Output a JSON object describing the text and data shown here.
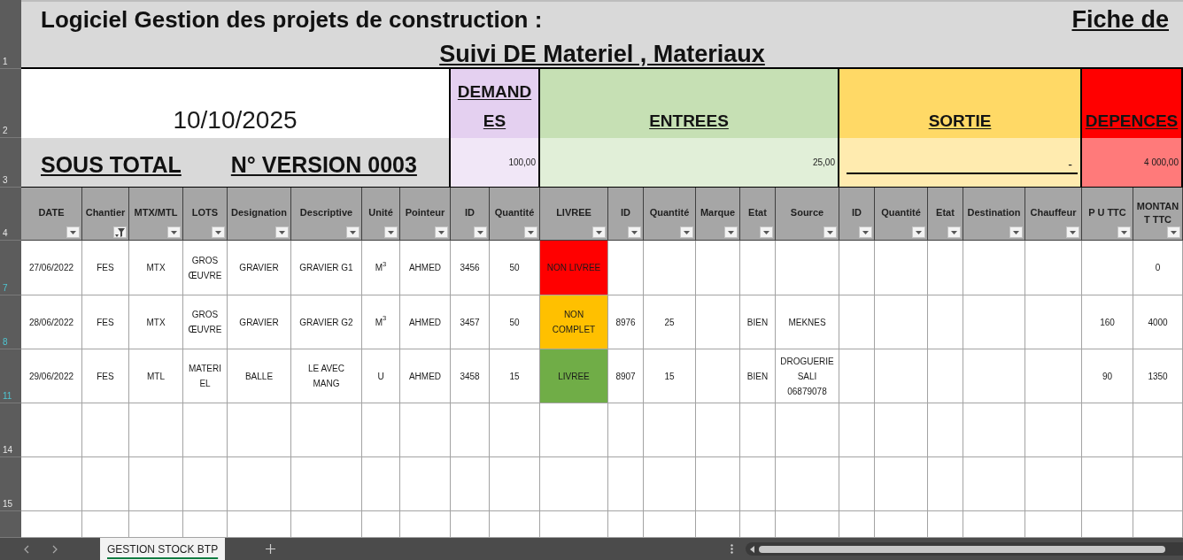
{
  "title_row": {
    "title": "Logiciel Gestion des projets de construction :",
    "right_title": "Fiche de",
    "subtitle": "Suivi DE Materiel , Materiaux"
  },
  "column_groups": [
    {
      "kind": "info",
      "date": "10/10/2025",
      "subtotal_label": "SOUS TOTAL",
      "version": "N° VERSION 0003",
      "columns": [
        {
          "label": "DATE",
          "filtered": false
        },
        {
          "label": "Chantier",
          "filtered": true
        },
        {
          "label": "MTX/MTL",
          "filtered": false
        },
        {
          "label": "LOTS",
          "filtered": false
        },
        {
          "label": "Designation",
          "filtered": false
        },
        {
          "label": "Descriptive",
          "filtered": false
        },
        {
          "label": "Unité",
          "filtered": false
        },
        {
          "label": "Pointeur",
          "filtered": false
        }
      ]
    },
    {
      "kind": "section",
      "label": "DEMANDES",
      "color": "#e4d0f0",
      "total": "100,00",
      "total_underlined": false,
      "columns": [
        {
          "label": "ID",
          "filtered": false
        },
        {
          "label": "Quantité",
          "filtered": false
        }
      ]
    },
    {
      "kind": "section",
      "label": "ENTREES",
      "color": "#c6e0b4",
      "total": "25,00",
      "total_underlined": false,
      "columns": [
        {
          "label": "LIVREE",
          "filtered": false
        },
        {
          "label": "ID",
          "filtered": false
        },
        {
          "label": "Quantité",
          "filtered": false
        },
        {
          "label": "Marque",
          "filtered": false
        },
        {
          "label": "Etat",
          "filtered": false
        },
        {
          "label": "Source",
          "filtered": false
        }
      ]
    },
    {
      "kind": "section",
      "label": "SORTIE",
      "color": "#ffd966",
      "total": "-",
      "total_underlined": true,
      "columns": [
        {
          "label": "ID",
          "filtered": false
        },
        {
          "label": "Quantité",
          "filtered": false
        },
        {
          "label": "Etat",
          "filtered": false
        },
        {
          "label": "Destination",
          "filtered": false
        },
        {
          "label": "Chauffeur",
          "filtered": false
        }
      ]
    },
    {
      "kind": "section",
      "label": "DEPENCES",
      "color": "#ff0000",
      "total": "4 000,00",
      "total_underlined": false,
      "columns": [
        {
          "label": "P U TTC",
          "filtered": false
        },
        {
          "label": "MONTANT TTC",
          "filtered": false
        }
      ]
    }
  ],
  "row_headers": [
    {
      "label": "1",
      "filtered": false
    },
    {
      "label": "2",
      "filtered": false
    },
    {
      "label": "3",
      "filtered": false
    },
    {
      "label": "4",
      "filtered": false
    },
    {
      "label": "7",
      "filtered": true
    },
    {
      "label": "8",
      "filtered": true
    },
    {
      "label": "11",
      "filtered": true
    },
    {
      "label": "14",
      "filtered": false
    },
    {
      "label": "15",
      "filtered": false
    }
  ],
  "rows": [
    {
      "cells": [
        "27/06/2022",
        "FES",
        "MTX",
        "GROS ŒUVRE",
        "GRAVIER",
        "GRAVIER G1",
        "M$^{3}$",
        "AHMED",
        "3456",
        "50",
        {
          "text": "NON LIVREE",
          "color": "#ff0000"
        },
        null,
        null,
        null,
        null,
        null,
        null,
        null,
        null,
        null,
        null,
        null,
        "0"
      ]
    },
    {
      "cells": [
        "28/06/2022",
        "FES",
        "MTX",
        "GROS ŒUVRE",
        "GRAVIER",
        "GRAVIER G2",
        "M$^{3}$",
        "AHMED",
        "3457",
        "50",
        {
          "text": "NON COMPLET",
          "color": "#ffc000"
        },
        "8976",
        "25",
        null,
        "BIEN",
        "MEKNES",
        null,
        null,
        null,
        null,
        null,
        "160",
        "4000"
      ]
    },
    {
      "cells": [
        "29/06/2022",
        "FES",
        "MTL",
        "MATERIEL",
        "BALLE",
        "LE AVEC MANG",
        "U",
        "AHMED",
        "3458",
        "15",
        {
          "text": "LIVREE",
          "color": "#70ad47"
        },
        "8907",
        "15",
        null,
        "BIEN",
        "DROGUERIE SALI 06879078",
        null,
        null,
        null,
        null,
        null,
        "90",
        "1350"
      ]
    }
  ],
  "sheet_tabs": [
    {
      "label": "GESTION STOCK BTP",
      "selected": true
    }
  ]
}
